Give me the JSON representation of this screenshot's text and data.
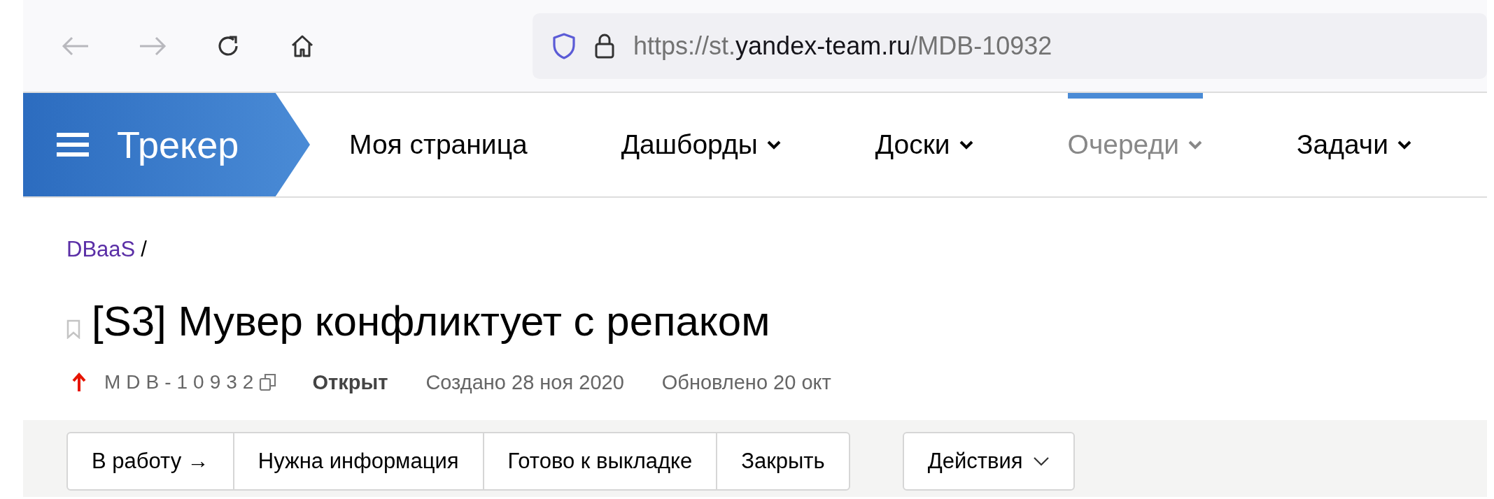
{
  "browser": {
    "url": {
      "scheme": "https://st.",
      "domain": "yandex-team.ru",
      "path": "/MDB-10932"
    }
  },
  "nav": {
    "logo": "Трекер",
    "items": [
      {
        "label": "Моя страница",
        "dropdown": false,
        "selected": false
      },
      {
        "label": "Дашборды",
        "dropdown": true,
        "selected": false
      },
      {
        "label": "Доски",
        "dropdown": true,
        "selected": false
      },
      {
        "label": "Очереди",
        "dropdown": true,
        "selected": true
      },
      {
        "label": "Задачи",
        "dropdown": true,
        "selected": false
      }
    ]
  },
  "breadcrumb": {
    "link": "DBaaS",
    "separator": "/"
  },
  "issue": {
    "title": "[S3] Мувер конфликтует с репаком",
    "key": "MDB-10932",
    "status": "Открыт",
    "created": "Создано 28 ноя 2020",
    "updated": "Обновлено 20 окт"
  },
  "actions": {
    "transitions": [
      "В работу →",
      "Нужна информация",
      "Готово к выкладке",
      "Закрыть"
    ],
    "menu": "Действия"
  }
}
